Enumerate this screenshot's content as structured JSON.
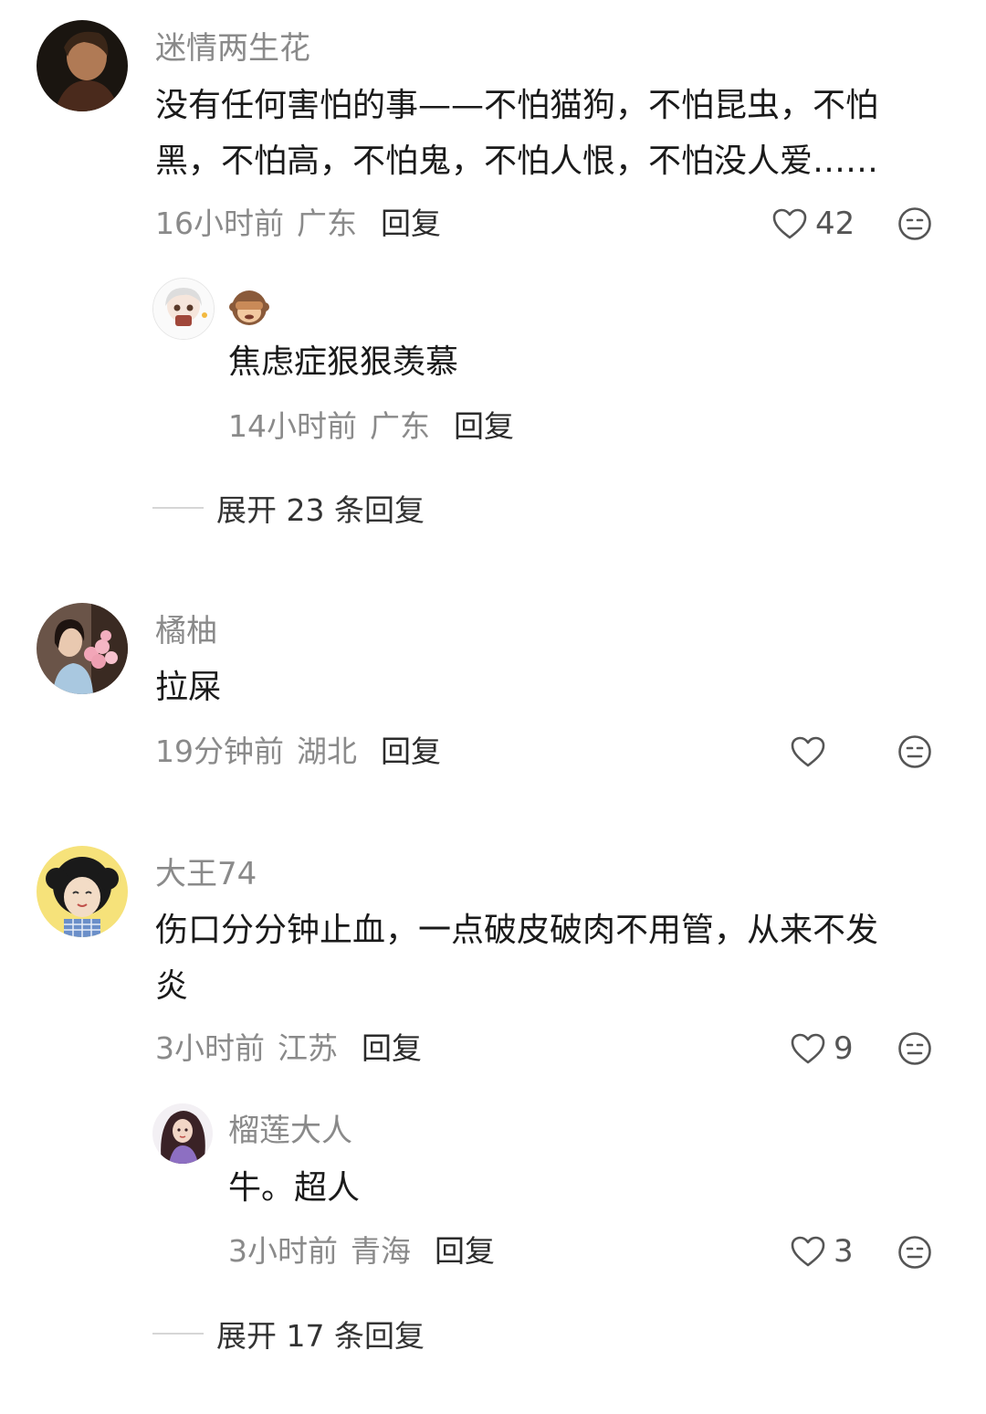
{
  "comments": [
    {
      "name": "迷情两生花",
      "text_line1": "没有任何害怕的事——不怕猫狗，不怕昆虫，不怕",
      "text_line2": "黑，不怕高，不怕鬼，不怕人恨，不怕没人爱……",
      "time": "16小时前",
      "location": "广东",
      "reply_label": "回复",
      "likes": "42",
      "avatar_icon": "man-portrait-avatar",
      "replies": [
        {
          "name": "",
          "name_emoji": "see-no-evil-monkey-emoji",
          "text": "焦虑症狠狠羡慕",
          "time": "14小时前",
          "location": "广东",
          "reply_label": "回复",
          "avatar_icon": "anime-girl-avatar"
        }
      ],
      "expand_label": "展开 23 条回复"
    },
    {
      "name": "橘柚",
      "text_line1": "拉屎",
      "time": "19分钟前",
      "location": "湖北",
      "reply_label": "回复",
      "likes": "",
      "avatar_icon": "woman-with-flowers-avatar"
    },
    {
      "name": "大王74",
      "text_line1": "伤口分分钟止血，一点破皮破肉不用管，从来不发",
      "text_line2": "炎",
      "time": "3小时前",
      "location": "江苏",
      "reply_label": "回复",
      "likes": "9",
      "avatar_icon": "cartoon-curly-hair-avatar",
      "replies": [
        {
          "name": "榴莲大人",
          "text": "牛。超人",
          "time": "3小时前",
          "location": "青海",
          "reply_label": "回复",
          "likes": "3",
          "avatar_icon": "curly-hair-woman-avatar"
        }
      ],
      "expand_label": "展开 17 条回复"
    }
  ],
  "colors": {
    "name": "#8a8a8a",
    "text": "#1a1a1a",
    "meta": "#8a8a8a",
    "reply": "#2b2b2b",
    "icon": "#555555"
  }
}
